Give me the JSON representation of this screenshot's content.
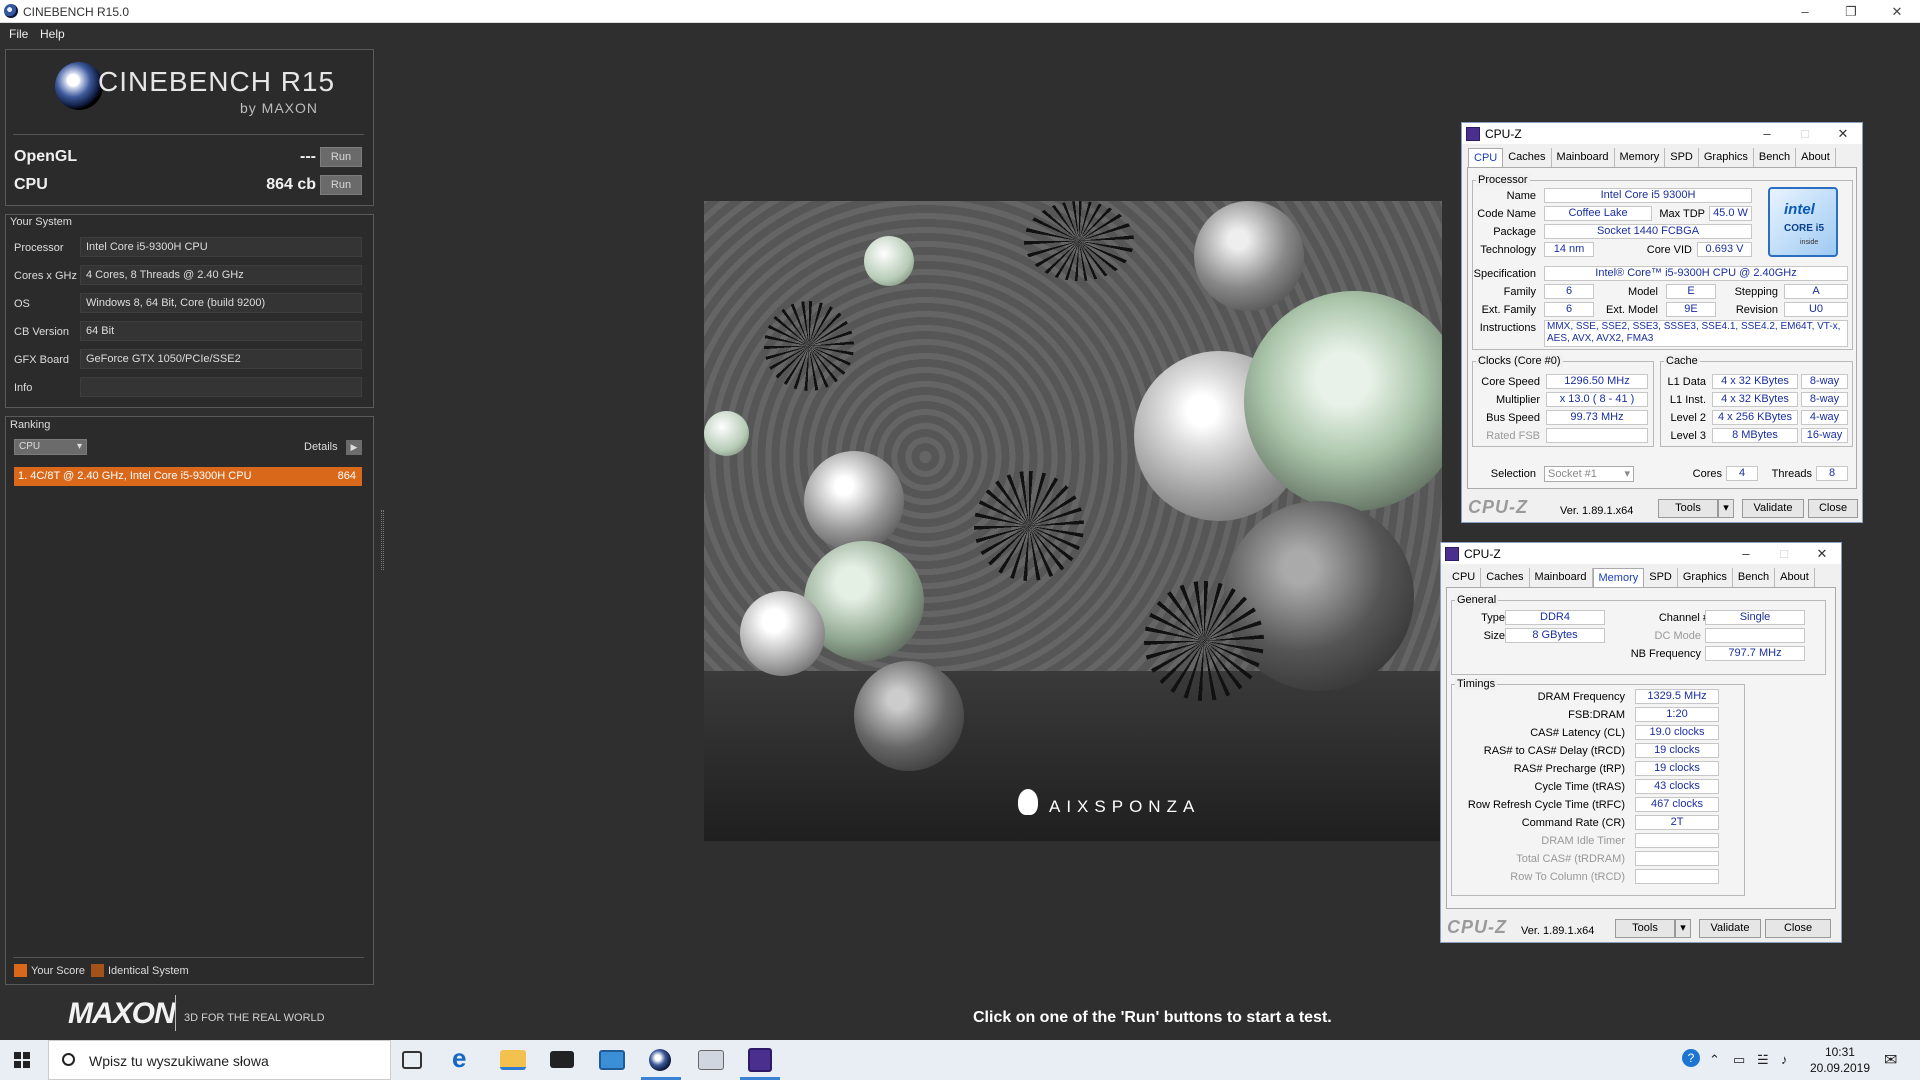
{
  "window": {
    "title": "CINEBENCH R15.0"
  },
  "menu": {
    "file": "File",
    "help": "Help"
  },
  "brand": {
    "name": "CINEBENCH R15",
    "by": "by MAXON"
  },
  "scores": {
    "opengl_label": "OpenGL",
    "opengl_value": "---",
    "cpu_label": "CPU",
    "cpu_value": "864 cb",
    "run_label": "Run"
  },
  "your_system": {
    "title": "Your System",
    "rows": [
      {
        "label": "Processor",
        "value": "Intel Core i5-9300H CPU"
      },
      {
        "label": "Cores x GHz",
        "value": "4 Cores, 8 Threads @ 2.40 GHz"
      },
      {
        "label": "OS",
        "value": "Windows 8, 64 Bit, Core (build 9200)"
      },
      {
        "label": "CB Version",
        "value": "64 Bit"
      },
      {
        "label": "GFX Board",
        "value": "GeForce GTX 1050/PCIe/SSE2"
      },
      {
        "label": "Info",
        "value": ""
      }
    ]
  },
  "ranking": {
    "title": "Ranking",
    "dropdown": "CPU",
    "details": "Details",
    "entry_text": "1. 4C/8T @ 2.40 GHz, Intel Core i5-9300H CPU",
    "entry_score": "864",
    "legend_your": "Your Score",
    "legend_identical": "Identical System"
  },
  "footer": {
    "maxon": "MAXON",
    "tagline": "3D FOR THE REAL WORLD",
    "status": "Click on one of the 'Run' buttons to start a test."
  },
  "render": {
    "watermark": "AIXSPONZA"
  },
  "colors": {
    "accent": "#d9681a",
    "legend_identical": "#a3531a",
    "cpuz_value": "#1a2fa0"
  },
  "cpuz_common": {
    "title": "CPU-Z",
    "tabs": [
      "CPU",
      "Caches",
      "Mainboard",
      "Memory",
      "SPD",
      "Graphics",
      "Bench",
      "About"
    ],
    "logo": "CPU-Z",
    "version": "Ver. 1.89.1.x64",
    "tools": "Tools",
    "validate": "Validate",
    "close": "Close"
  },
  "cpuz_cpu": {
    "processor_title": "Processor",
    "name_label": "Name",
    "name": "Intel Core i5 9300H",
    "codename_label": "Code Name",
    "codename": "Coffee Lake",
    "maxtdp_label": "Max TDP",
    "maxtdp": "45.0 W",
    "package_label": "Package",
    "package": "Socket 1440 FCBGA",
    "technology_label": "Technology",
    "technology": "14 nm",
    "corevid_label": "Core VID",
    "corevid": "0.693 V",
    "spec_label": "Specification",
    "spec": "Intel® Core™ i5-9300H CPU @ 2.40GHz",
    "family_label": "Family",
    "family": "6",
    "model_label": "Model",
    "model": "E",
    "stepping_label": "Stepping",
    "stepping": "A",
    "extfamily_label": "Ext. Family",
    "extfamily": "6",
    "extmodel_label": "Ext. Model",
    "extmodel": "9E",
    "revision_label": "Revision",
    "revision": "U0",
    "instructions_label": "Instructions",
    "instructions_1": "MMX, SSE, SSE2, SSE3, SSSE3, SSE4.1, SSE4.2, EM64T, VT-x,",
    "instructions_2": "AES, AVX, AVX2, FMA3",
    "clocks_title": "Clocks (Core #0)",
    "corespeed_label": "Core Speed",
    "corespeed": "1296.50 MHz",
    "multiplier_label": "Multiplier",
    "multiplier": "x 13.0 ( 8 - 41 )",
    "busspeed_label": "Bus Speed",
    "busspeed": "99.73 MHz",
    "ratedfsb_label": "Rated FSB",
    "ratedfsb": "",
    "cache_title": "Cache",
    "l1data_label": "L1 Data",
    "l1data": "4 x 32 KBytes",
    "l1data_way": "8-way",
    "l1inst_label": "L1 Inst.",
    "l1inst": "4 x 32 KBytes",
    "l1inst_way": "8-way",
    "l2_label": "Level 2",
    "l2": "4 x 256 KBytes",
    "l2_way": "4-way",
    "l3_label": "Level 3",
    "l3": "8 MBytes",
    "l3_way": "16-way",
    "selection_label": "Selection",
    "selection": "Socket #1",
    "cores_label": "Cores",
    "cores": "4",
    "threads_label": "Threads",
    "threads": "8",
    "intel_logo": "intel",
    "intel_core": "CORE i5",
    "intel_inside": "inside"
  },
  "cpuz_mem": {
    "general_title": "General",
    "type_label": "Type",
    "type": "DDR4",
    "size_label": "Size",
    "size": "8 GBytes",
    "channel_label": "Channel #",
    "channel": "Single",
    "dcmode_label": "DC Mode",
    "dcmode": "",
    "nbfreq_label": "NB Frequency",
    "nbfreq": "797.7 MHz",
    "timings_title": "Timings",
    "timings": [
      {
        "label": "DRAM Frequency",
        "value": "1329.5 MHz"
      },
      {
        "label": "FSB:DRAM",
        "value": "1:20"
      },
      {
        "label": "CAS# Latency (CL)",
        "value": "19.0 clocks"
      },
      {
        "label": "RAS# to CAS# Delay (tRCD)",
        "value": "19 clocks"
      },
      {
        "label": "RAS# Precharge (tRP)",
        "value": "19 clocks"
      },
      {
        "label": "Cycle Time (tRAS)",
        "value": "43 clocks"
      },
      {
        "label": "Row Refresh Cycle Time (tRFC)",
        "value": "467 clocks"
      },
      {
        "label": "Command Rate (CR)",
        "value": "2T"
      },
      {
        "label": "DRAM Idle Timer",
        "value": ""
      },
      {
        "label": "Total CAS# (tRDRAM)",
        "value": ""
      },
      {
        "label": "Row To Column (tRCD)",
        "value": ""
      }
    ]
  },
  "taskbar": {
    "search_placeholder": "Wpisz tu wyszukiwane słowa",
    "time": "10:31",
    "date": "20.09.2019"
  }
}
